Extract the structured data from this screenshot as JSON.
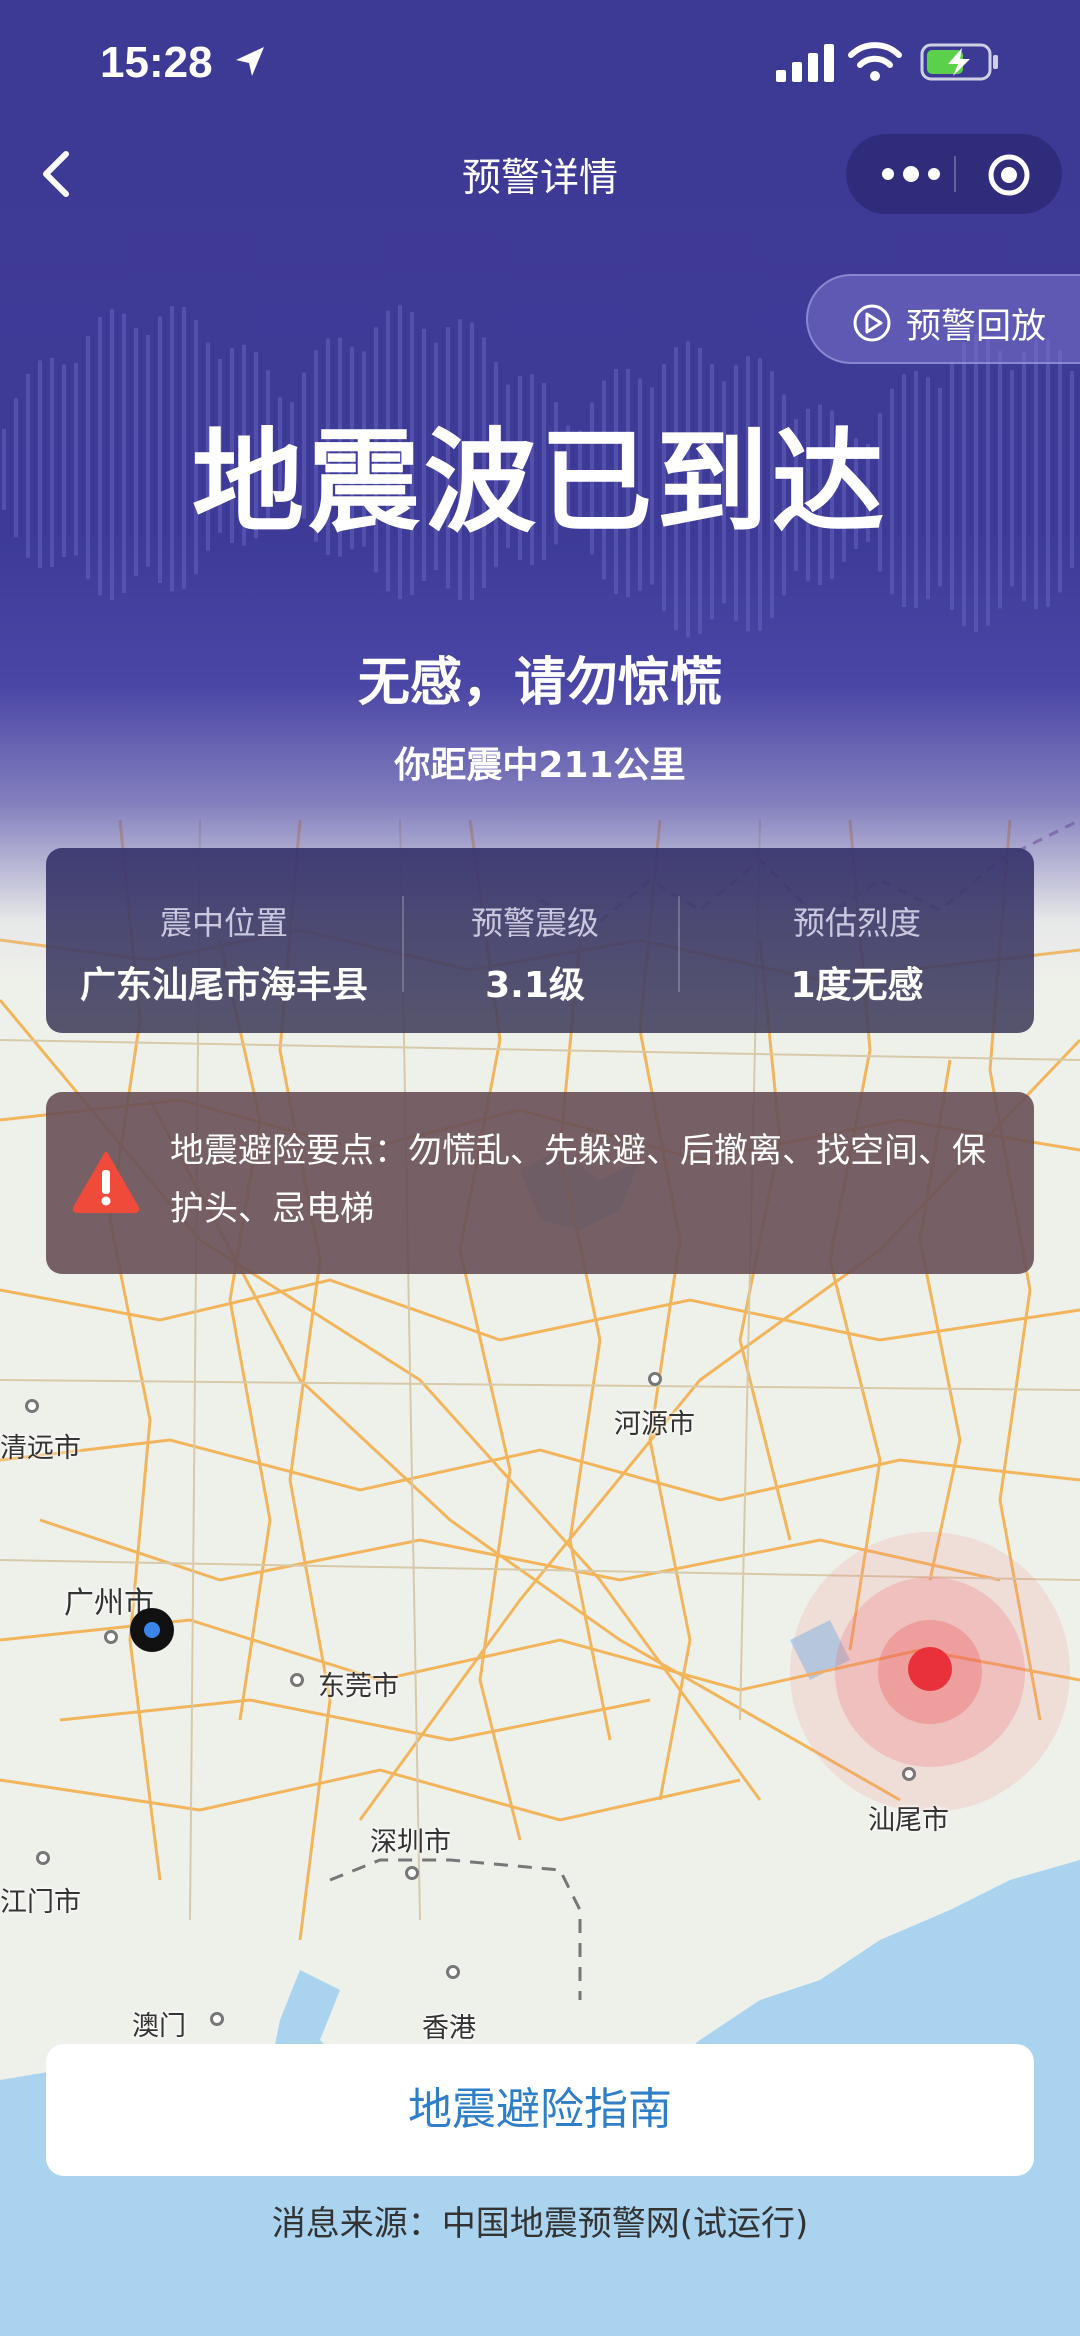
{
  "status_bar": {
    "time": "15:28"
  },
  "nav": {
    "title": "预警详情"
  },
  "replay": {
    "label": "预警回放"
  },
  "alert": {
    "headline": "地震波已到达",
    "feel": "无感，请勿惊慌",
    "distance": "你距震中211公里"
  },
  "info": [
    {
      "label": "震中位置",
      "value": "广东汕尾市海丰县"
    },
    {
      "label": "预警震级",
      "value": "3.1级"
    },
    {
      "label": "预估烈度",
      "value": "1度无感"
    }
  ],
  "tips": {
    "text": "地震避险要点：勿慌乱、先躲避、后撤离、找空间、保护头、忌电梯"
  },
  "map": {
    "cities": [
      "清远市",
      "河源市",
      "广州市",
      "东莞市",
      "汕尾市",
      "深圳市",
      "江门市",
      "澳门",
      "香港"
    ]
  },
  "guide_button": {
    "label": "地震避险指南"
  },
  "source": {
    "text": "消息来源：中国地震预警网(试运行)"
  },
  "colors": {
    "header": "#3d3a95",
    "accent": "#2f7ec8",
    "epicenter": "#e8313a",
    "sea": "#a9d3ef"
  }
}
